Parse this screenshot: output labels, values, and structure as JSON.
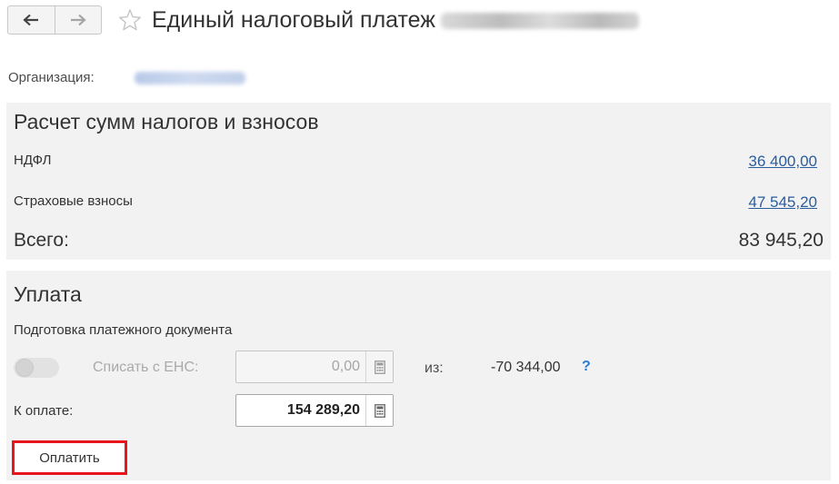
{
  "header": {
    "back_icon": "arrow-left-icon",
    "forward_icon": "arrow-right-icon",
    "favorite_icon": "star-icon",
    "title": "Единый налоговый платеж"
  },
  "organization": {
    "label": "Организация:"
  },
  "calculation": {
    "title": "Расчет сумм налогов и взносов",
    "rows": [
      {
        "label": "НДФЛ",
        "value": "36 400,00"
      },
      {
        "label": "Страховые взносы",
        "value": "47 545,20"
      }
    ],
    "total_label": "Всего:",
    "total_value": "83 945,20"
  },
  "payment": {
    "title": "Уплата",
    "subtitle": "Подготовка платежного документа",
    "ens_toggle_label": "Списать с ЕНС:",
    "ens_amount": "0,00",
    "from_label": "из:",
    "ens_balance": "-70 344,00",
    "help": "?",
    "to_pay_label": "К оплате:",
    "to_pay_amount": "154 289,20",
    "calculator_icon": "calculator-icon",
    "pay_button": "Оплатить"
  },
  "colors": {
    "link": "#2a5d9f",
    "help": "#2a7dd4",
    "highlight_border": "#e8151f",
    "panel_bg": "#f2f2f2"
  }
}
